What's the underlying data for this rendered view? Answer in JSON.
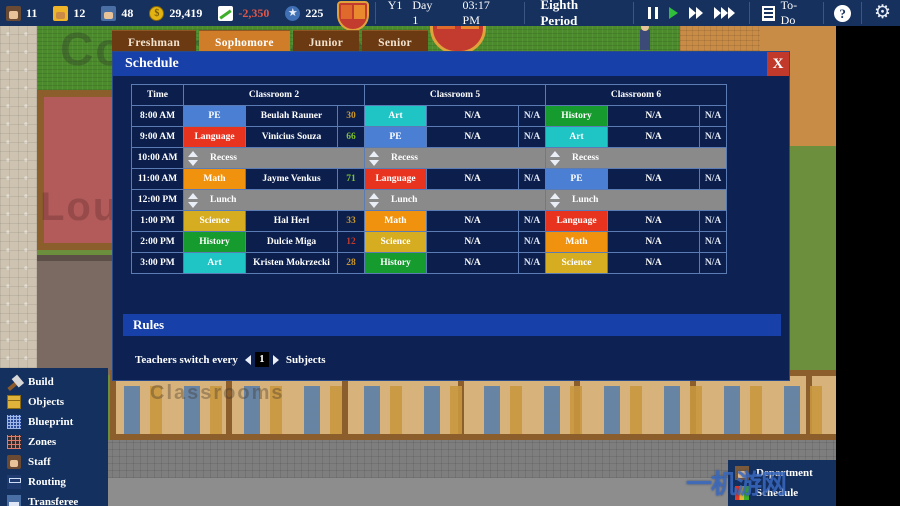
{
  "topbar": {
    "stats": [
      {
        "icon": "teacher-icon",
        "value": "11"
      },
      {
        "icon": "worker-icon",
        "value": "12"
      },
      {
        "icon": "student-icon",
        "value": "48"
      },
      {
        "icon": "money-icon",
        "value": "29,419"
      },
      {
        "icon": "trend-icon",
        "value": "-2,350"
      },
      {
        "icon": "star-icon",
        "value": "225"
      }
    ],
    "crest_icon": "school-crest-icon",
    "year": "Y1",
    "day": "Day 1",
    "time": "03:17 PM",
    "period": "Eighth Period",
    "speed_pause_icon": "pause-icon",
    "speed_play_icon": "play-icon",
    "speed_fast_icon": "fast-forward-icon",
    "speed_fastest_icon": "fastest-forward-icon",
    "todo_icon": "list-icon",
    "todo_label": "To-Do",
    "help_icon": "help-icon",
    "help_label": "?",
    "settings_icon": "gear-icon"
  },
  "year_tabs": [
    {
      "label": "Freshman",
      "active": false
    },
    {
      "label": "Sophomore",
      "active": true
    },
    {
      "label": "Junior",
      "active": false
    },
    {
      "label": "Senior",
      "active": false
    }
  ],
  "modal": {
    "title": "Schedule",
    "close_label": "X",
    "close_icon": "close-icon"
  },
  "schedule": {
    "headers": [
      {
        "label": "Time",
        "span": 1
      },
      {
        "label": "Classroom 2",
        "span": 3
      },
      {
        "label": "Classroom 5",
        "span": 3
      },
      {
        "label": "Classroom 6",
        "span": 3
      }
    ],
    "na_label": "N/A",
    "spinner_icon": "spinner-up-down-icon",
    "rows": [
      {
        "time": "8:00 AM",
        "type": "class",
        "cells": [
          {
            "subject": "PE",
            "color": "#4a7fd4",
            "teacher": "Beulah Rauner",
            "score": "30",
            "score_color": "#c8972e"
          },
          {
            "subject": "Art",
            "color": "#1fc4c4",
            "teacher": "N/A",
            "score": "N/A",
            "score_color": "#dfe6f5"
          },
          {
            "subject": "History",
            "color": "#159b2e",
            "teacher": "N/A",
            "score": "N/A",
            "score_color": "#dfe6f5"
          }
        ]
      },
      {
        "time": "9:00 AM",
        "type": "class",
        "cells": [
          {
            "subject": "Language",
            "color": "#e8341f",
            "teacher": "Vinicius Souza",
            "score": "66",
            "score_color": "#7fc12e"
          },
          {
            "subject": "PE",
            "color": "#4a7fd4",
            "teacher": "N/A",
            "score": "N/A",
            "score_color": "#dfe6f5"
          },
          {
            "subject": "Art",
            "color": "#1fc4c4",
            "teacher": "N/A",
            "score": "N/A",
            "score_color": "#dfe6f5"
          }
        ]
      },
      {
        "time": "10:00 AM",
        "type": "break",
        "label": "Recess"
      },
      {
        "time": "11:00 AM",
        "type": "class",
        "cells": [
          {
            "subject": "Math",
            "color": "#f0920e",
            "teacher": "Jayme Venkus",
            "score": "71",
            "score_color": "#7fc12e"
          },
          {
            "subject": "Language",
            "color": "#e8341f",
            "teacher": "N/A",
            "score": "N/A",
            "score_color": "#dfe6f5"
          },
          {
            "subject": "PE",
            "color": "#4a7fd4",
            "teacher": "N/A",
            "score": "N/A",
            "score_color": "#dfe6f5"
          }
        ]
      },
      {
        "time": "12:00 PM",
        "type": "break",
        "label": "Lunch"
      },
      {
        "time": "1:00 PM",
        "type": "class",
        "cells": [
          {
            "subject": "Science",
            "color": "#d6ad20",
            "teacher": "Hal Herl",
            "score": "33",
            "score_color": "#c8972e"
          },
          {
            "subject": "Math",
            "color": "#f0920e",
            "teacher": "N/A",
            "score": "N/A",
            "score_color": "#dfe6f5"
          },
          {
            "subject": "Language",
            "color": "#e8341f",
            "teacher": "N/A",
            "score": "N/A",
            "score_color": "#dfe6f5"
          }
        ]
      },
      {
        "time": "2:00 PM",
        "type": "class",
        "cells": [
          {
            "subject": "History",
            "color": "#159b2e",
            "teacher": "Dulcie Miga",
            "score": "12",
            "score_color": "#c0392b"
          },
          {
            "subject": "Science",
            "color": "#d6ad20",
            "teacher": "N/A",
            "score": "N/A",
            "score_color": "#dfe6f5"
          },
          {
            "subject": "Math",
            "color": "#f0920e",
            "teacher": "N/A",
            "score": "N/A",
            "score_color": "#dfe6f5"
          }
        ]
      },
      {
        "time": "3:00 PM",
        "type": "class",
        "cells": [
          {
            "subject": "Art",
            "color": "#1fc4c4",
            "teacher": "Kristen Mokrzecki",
            "score": "28",
            "score_color": "#c8972e"
          },
          {
            "subject": "History",
            "color": "#159b2e",
            "teacher": "N/A",
            "score": "N/A",
            "score_color": "#dfe6f5"
          },
          {
            "subject": "Science",
            "color": "#d6ad20",
            "teacher": "N/A",
            "score": "N/A",
            "score_color": "#dfe6f5"
          }
        ]
      }
    ]
  },
  "rules": {
    "title": "Rules",
    "text_before": "Teachers switch every",
    "value": "1",
    "text_after": "Subjects",
    "dec_icon": "chevron-left-icon",
    "inc_icon": "chevron-right-icon"
  },
  "left_menu": [
    {
      "label": "Build",
      "icon": "hammer-icon"
    },
    {
      "label": "Objects",
      "icon": "box-icon"
    },
    {
      "label": "Blueprint",
      "icon": "grid-icon"
    },
    {
      "label": "Zones",
      "icon": "zones-icon"
    },
    {
      "label": "Staff",
      "icon": "staff-icon"
    },
    {
      "label": "Routing",
      "icon": "routing-icon"
    },
    {
      "label": "Transferee",
      "icon": "transferee-icon"
    }
  ],
  "right_menu": [
    {
      "label": "Department",
      "icon": "department-icon"
    },
    {
      "label": "Schedule",
      "icon": "schedule-icon"
    }
  ],
  "world_text": {
    "line1": "Common Area",
    "line2": "Lounge",
    "line3": "Classrooms"
  },
  "watermark": {
    "text": "一机游网"
  },
  "colors": {
    "modal_bg": "#0d2252",
    "header_blue": "#1740a8",
    "topbar_bg": "#16315e",
    "tab_active": "#d07d2a",
    "tab_inactive": "#6b3a12",
    "close_red": "#c0392b"
  }
}
